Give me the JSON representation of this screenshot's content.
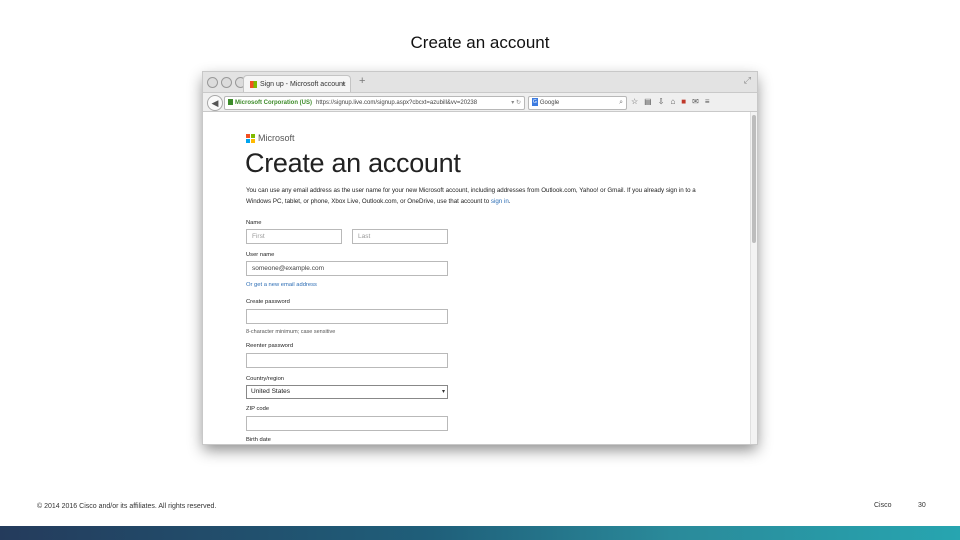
{
  "slide": {
    "title": "Create an account",
    "footer_copyright": "© 2014 2016 Cisco and/or its affiliates. All rights reserved.",
    "footer_brand": "Cisco",
    "page_number": "30"
  },
  "browser": {
    "tab_title": "Sign up - Microsoft account",
    "tab_close": "×",
    "new_tab": "+",
    "identity": "Microsoft Corporation (US)",
    "url": "https://signup.live.com/signup.aspx?cbcxt=azubill&vv=20238",
    "search_engine_badge": "G",
    "search_placeholder": "Google",
    "icons": [
      "back-icon",
      "lock-icon",
      "reload-icon",
      "search-icon",
      "star-icon",
      "bookmarks-icon",
      "download-icon",
      "home-icon",
      "addon-icon",
      "chat-icon",
      "menu-icon"
    ]
  },
  "page": {
    "logo_text": "Microsoft",
    "heading": "Create an account",
    "intro": "You can use any email address as the user name for your new Microsoft account, including addresses from Outlook.com, Yahoo! or Gmail. If you already sign in to a Windows PC, tablet, or phone, Xbox Live, Outlook.com, or OneDrive, use that account to",
    "intro_link": "sign in",
    "intro_end": ".",
    "name_label": "Name",
    "first_placeholder": "First",
    "last_placeholder": "Last",
    "username_label": "User name",
    "username_value": "someone@example.com",
    "new_email_link": "Or get a new email address",
    "create_password_label": "Create password",
    "password_hint": "8-character minimum; case sensitive",
    "reenter_password_label": "Reenter password",
    "country_label": "Country/region",
    "country_value": "United States",
    "zip_label": "ZIP code",
    "birthdate_label": "Birth date"
  }
}
